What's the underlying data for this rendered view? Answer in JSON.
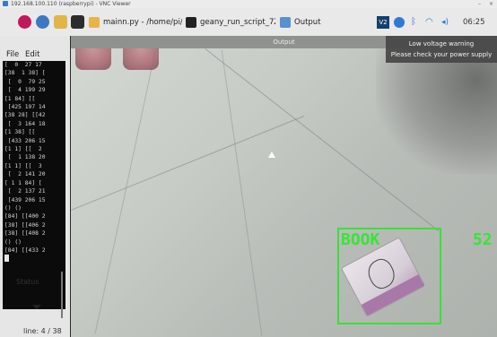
{
  "vnc": {
    "title": "192.168.100.110 (raspberrypi) - VNC Viewer"
  },
  "taskbar": {
    "tasks": [
      {
        "label": "mainn.py - /home/pi/De..."
      },
      {
        "label": "geany_run_script_7ZK..."
      },
      {
        "label": "Output"
      }
    ],
    "clock": "06:25"
  },
  "app_left": {
    "menu": [
      "File",
      "Edit"
    ],
    "terminal_lines": [
      "[  0  27 17",
      "[38  1 38] [",
      " [  0  79 25",
      " [  4 199 29",
      "[1 84] [[  ",
      " [425 197 14",
      "[38 28] [[42",
      " [  3 164 18",
      "[1 38] [[  ",
      " [433 206 15",
      "[1 1] [[  2",
      " [  1 138 20",
      "[1 1] [[  3",
      " [  2 141 20",
      "[ 1 1 84] [",
      " [  2 137 21",
      " [439 206 15",
      "() ()",
      "[84] [[400 2",
      "[38] [[406 2",
      "[38] [[408 2",
      "() ()",
      "[84] [[433 2"
    ],
    "status_label": "Status",
    "line_info": "line: 4 / 38"
  },
  "output_window": {
    "title": "Output",
    "detection": {
      "label": "BOOK",
      "score": "52"
    }
  },
  "notification": {
    "title": "Low voltage warning",
    "message": "Please check your power supply"
  },
  "colors": {
    "detection_green": "#37e537",
    "terminal_bg": "#0b0b0b"
  }
}
